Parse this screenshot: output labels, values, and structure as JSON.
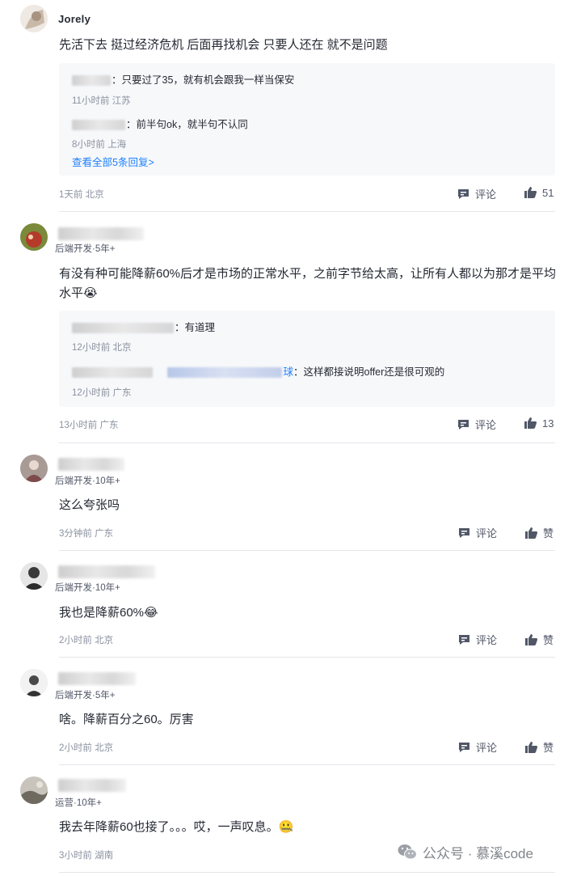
{
  "labels": {
    "comment": "评论",
    "like": "赞"
  },
  "comments": [
    {
      "name": "Jorely",
      "text": "先活下去 挺过经济危机 后面再找机会 只要人还在 就不是问题",
      "replies": [
        {
          "text": "：只要过了35，就有机会跟我一样当保安",
          "meta": "11小时前 江苏"
        },
        {
          "text": "：前半句ok，就半句不认同",
          "meta": "8小时前 上海"
        }
      ],
      "more": "查看全部5条回复>",
      "time": "1天前 北京",
      "likes": "51"
    },
    {
      "meta": "后端开发·5年+",
      "text": "有没有种可能降薪60%后才是市场的正常水平，之前字节给太高，让所有人都以为那才是平均水平😭",
      "replies": [
        {
          "text": "：有道理",
          "meta": "12小时前 北京"
        },
        {
          "mid": "球",
          "text": "：这样都接说明offer还是很可观的",
          "meta": "12小时前 广东"
        }
      ],
      "time": "13小时前 广东",
      "likes": "13"
    },
    {
      "meta": "后端开发·10年+",
      "text": "这么夸张吗",
      "time": "3分钟前 广东"
    },
    {
      "meta": "后端开发·10年+",
      "text": "我也是降薪60%😂",
      "time": "2小时前 北京"
    },
    {
      "meta": "后端开发·5年+",
      "text": "啥。降薪百分之60。厉害",
      "time": "2小时前 北京"
    },
    {
      "meta": "运营·10年+",
      "text": "我去年降薪60也接了。。。哎，一声叹息。🤐",
      "time": "3小时前 湖南"
    }
  ],
  "watermark": "公众号 · 慕溪code",
  "icons": {
    "comment": "comment-icon",
    "like": "thumbs-up-icon",
    "watermark": "wechat-icon"
  }
}
